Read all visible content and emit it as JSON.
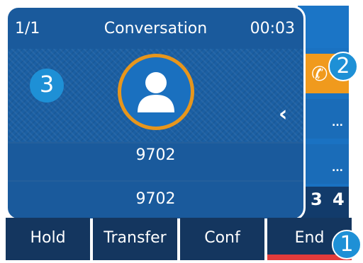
{
  "header": {
    "page_indicator": "1/1",
    "title": "Conversation",
    "timer": "00:03"
  },
  "contact": {
    "avatar_icon": "person-icon",
    "name": "9702",
    "number": "9702"
  },
  "side_panel": {
    "active_icon": "phone-icon",
    "item_1_text": "...",
    "item_2_text": "...",
    "bottom_text": "3 4"
  },
  "softkeys": {
    "hold": "Hold",
    "transfer": "Transfer",
    "conf": "Conf",
    "end": "End"
  },
  "callouts": {
    "one": "1",
    "two": "2",
    "three": "3"
  },
  "colors": {
    "screen_blue": "#1a5a9c",
    "softkey_bg": "#14365f",
    "accent_orange": "#f09a1d",
    "end_red": "#e23b3b",
    "callout_blue": "#1e90d6"
  }
}
